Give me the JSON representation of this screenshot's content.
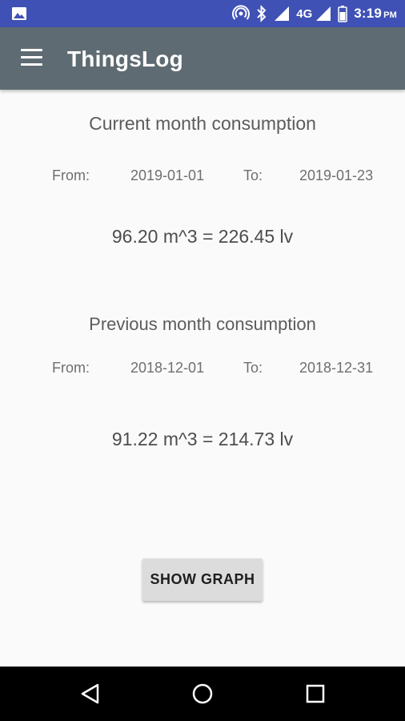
{
  "status_bar": {
    "network": "4G",
    "time": "3:19",
    "ampm": "PM",
    "icons": [
      "image-icon",
      "hotspot-icon",
      "bluetooth-icon",
      "signal-icon",
      "signal-4g-icon",
      "battery-icon"
    ]
  },
  "app_bar": {
    "title": "ThingsLog",
    "menu_icon": "menu-icon"
  },
  "current": {
    "title": "Current month consumption",
    "from_label": "From:",
    "from_date": "2019-01-01",
    "to_label": "To:",
    "to_date": "2019-01-23",
    "reading": "96.20 m^3 = 226.45 lv"
  },
  "previous": {
    "title": "Previous month consumption",
    "from_label": "From:",
    "from_date": "2018-12-01",
    "to_label": "To:",
    "to_date": "2018-12-31",
    "reading": "91.22 m^3 = 214.73 lv"
  },
  "actions": {
    "show_graph_label": "SHOW GRAPH"
  },
  "nav_bar": {
    "icons": [
      "back-icon",
      "home-icon",
      "recents-icon"
    ]
  },
  "colors": {
    "status_bar": "#3f51b5",
    "app_bar": "#5f6b72",
    "background": "#fafafa"
  }
}
